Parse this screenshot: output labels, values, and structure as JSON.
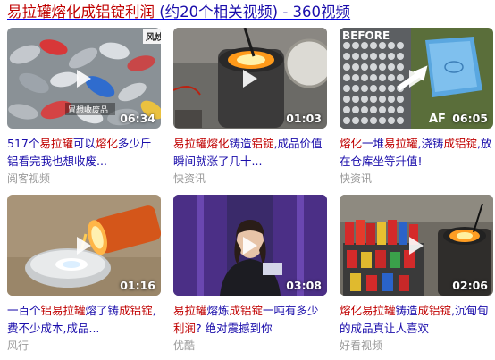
{
  "header": {
    "title_red": "易拉罐熔化成铝锭利润",
    "title_blue": " (约20个相关视频) - 360视频"
  },
  "videos": [
    {
      "duration": "06:34",
      "title_parts": [
        {
          "text": "517个",
          "hl": false
        },
        {
          "text": "易拉罐",
          "hl": true
        },
        {
          "text": "可以",
          "hl": false
        },
        {
          "text": "熔化",
          "hl": true
        },
        {
          "text": "多少斤铝看完我也想收废...",
          "hl": false
        }
      ],
      "source": "阅客视频",
      "watermark": "风炒",
      "caption": "冒想收废品"
    },
    {
      "duration": "01:03",
      "title_parts": [
        {
          "text": "易拉罐",
          "hl": true
        },
        {
          "text": "熔化",
          "hl": true
        },
        {
          "text": "铸造",
          "hl": false
        },
        {
          "text": "铝锭",
          "hl": true
        },
        {
          "text": ",成品价值 瞬间就涨了几十...",
          "hl": false
        }
      ],
      "source": "快资讯"
    },
    {
      "duration": "06:05",
      "title_parts": [
        {
          "text": "熔化",
          "hl": true
        },
        {
          "text": "一堆",
          "hl": false
        },
        {
          "text": "易拉罐",
          "hl": true
        },
        {
          "text": ",浇铸",
          "hl": false
        },
        {
          "text": "成铝锭",
          "hl": true
        },
        {
          "text": ",放在仓库坐等升值!",
          "hl": false
        }
      ],
      "source": "快资讯",
      "overlay_top": "BEFORE",
      "overlay_bottom": "AF"
    },
    {
      "duration": "01:16",
      "title_parts": [
        {
          "text": "一百个",
          "hl": false
        },
        {
          "text": "铝",
          "hl": true
        },
        {
          "text": "易拉罐",
          "hl": true
        },
        {
          "text": "熔了铸",
          "hl": false
        },
        {
          "text": "成铝锭",
          "hl": true
        },
        {
          "text": ",费不少成本,成品...",
          "hl": false
        }
      ],
      "source": "风行"
    },
    {
      "duration": "03:08",
      "title_parts": [
        {
          "text": "易拉罐",
          "hl": true
        },
        {
          "text": "熔炼",
          "hl": false
        },
        {
          "text": "成铝锭",
          "hl": true
        },
        {
          "text": "一吨有多少",
          "hl": false
        },
        {
          "text": "利润",
          "hl": true
        },
        {
          "text": "? 绝对震撼到你",
          "hl": false
        }
      ],
      "source": "优酷"
    },
    {
      "duration": "02:06",
      "title_parts": [
        {
          "text": "熔化",
          "hl": true
        },
        {
          "text": "易拉罐",
          "hl": true
        },
        {
          "text": "铸造",
          "hl": false
        },
        {
          "text": "成铝锭",
          "hl": true
        },
        {
          "text": ",沉甸甸的成品真让人喜欢",
          "hl": false
        }
      ],
      "source": "好看视频"
    }
  ],
  "colors": {
    "highlight": "#c00000",
    "link": "#1a0dab",
    "source": "#9a9a9a"
  },
  "icons": {
    "play": "play-icon"
  }
}
